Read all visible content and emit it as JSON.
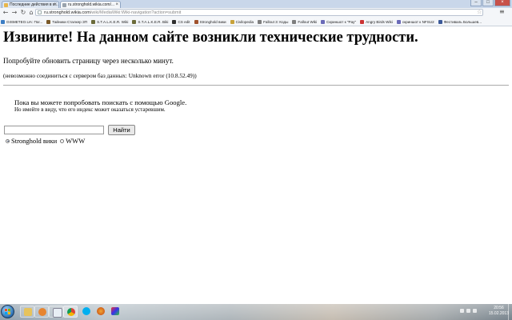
{
  "browser": {
    "tabs": [
      {
        "label": "Последние действия в в...",
        "active": false
      },
      {
        "label": "ru.stronghold.wikia.com/...",
        "active": true
      }
    ],
    "url": {
      "host": "ru.stronghold.wikia.com",
      "path": "/wiki/MediaWiki:Wiki-navigation?action=submit"
    },
    "bookmarks": [
      {
        "label": "GISMETEO.UA: Пог...",
        "color": "#3c7dc4"
      },
      {
        "label": "Тайники Сталкер ЗП",
        "color": "#7a5a2a"
      },
      {
        "label": "S.T.A.L.K.E.R. Wiki",
        "color": "#6b6b3a"
      },
      {
        "label": "S.T.A.L.K.E.R. Biki",
        "color": "#6b6b3a"
      },
      {
        "label": "CS edit",
        "color": "#2f2f2f"
      },
      {
        "label": "Stronghold вики",
        "color": "#a0522d"
      },
      {
        "label": "Civilopedia",
        "color": "#c8a23a"
      },
      {
        "label": "Fallout 3: Коды",
        "color": "#7d7d7d"
      },
      {
        "label": "Fallout Wiki",
        "color": "#7d7d7d"
      },
      {
        "label": "Скриншот к \"Pay\"",
        "color": "#6a6ab8"
      },
      {
        "label": "Angry Birds Wiki",
        "color": "#c33"
      },
      {
        "label": "скриншот к NFSU2",
        "color": "#6a6ab8"
      },
      {
        "label": "Фестиваль Большев...",
        "color": "#3b5998"
      }
    ]
  },
  "page": {
    "title": "Извините! На данном сайте возникли технические трудности.",
    "retry_text": "Попробуйте обновить страницу через несколько минут.",
    "db_error": "(невозможно соединиться с сервером баз данных: Unknown error (10.8.52.49))",
    "google_text": "Пока вы можете попробовать поискать с помощью Google.",
    "google_note": "Но имейте в виду, что его индекс может оказаться устаревшим.",
    "search": {
      "value": "",
      "button_label": "Найти",
      "options": [
        {
          "label": "Stronghold вики",
          "selected": true
        },
        {
          "label": "WWW",
          "selected": false
        }
      ]
    }
  },
  "taskbar": {
    "apps": [
      "Explorer",
      "Windows Media Player",
      "Document",
      "Google Chrome",
      "Skype",
      "Firefox",
      "Paint"
    ],
    "time": "20:56",
    "date": "15.02.2013"
  }
}
